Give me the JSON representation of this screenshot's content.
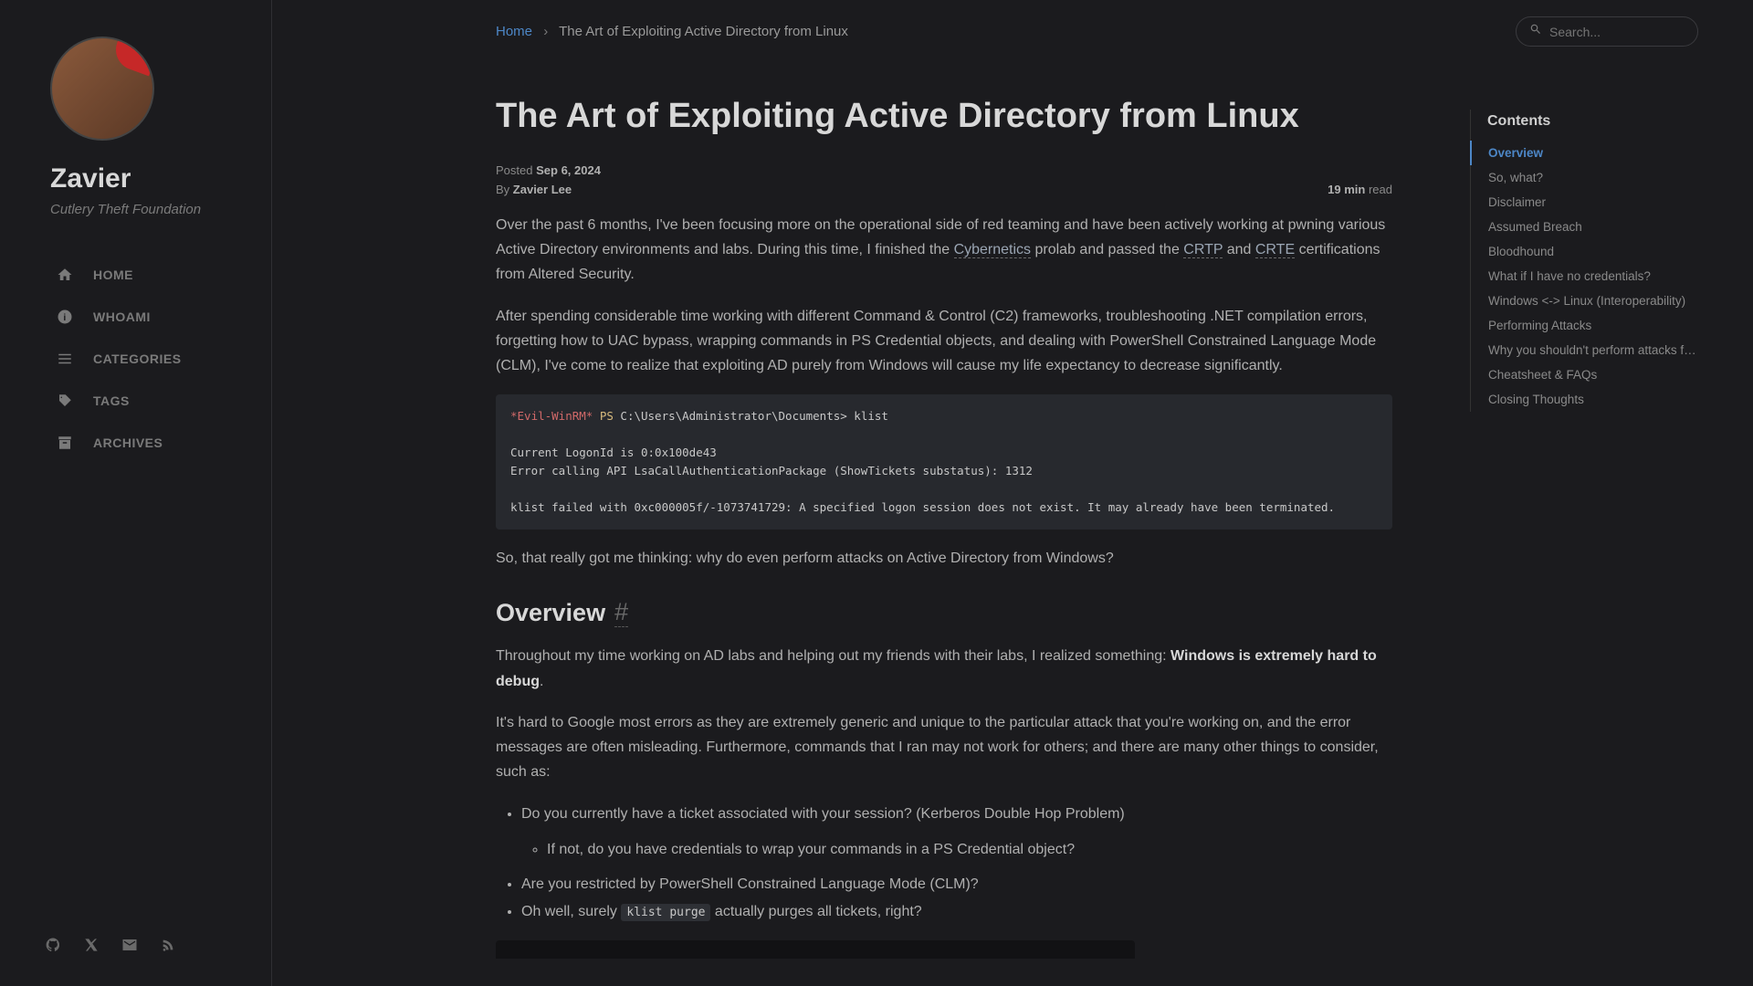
{
  "site": {
    "title": "Zavier",
    "subtitle": "Cutlery Theft Foundation"
  },
  "nav": [
    {
      "label": "HOME",
      "icon": "home"
    },
    {
      "label": "WHOAMI",
      "icon": "info"
    },
    {
      "label": "CATEGORIES",
      "icon": "list"
    },
    {
      "label": "TAGS",
      "icon": "tag"
    },
    {
      "label": "ARCHIVES",
      "icon": "archive"
    }
  ],
  "breadcrumb": {
    "home": "Home",
    "current": "The Art of Exploiting Active Directory from Linux"
  },
  "search": {
    "placeholder": "Search..."
  },
  "post": {
    "title": "The Art of Exploiting Active Directory from Linux",
    "posted_label": "Posted",
    "date": "Sep 6, 2024",
    "by_label": "By",
    "author": "Zavier Lee",
    "read_time_num": "19 min",
    "read_time_label": " read",
    "p1a": "Over the past 6 months, I've been focusing more on the operational side of red teaming and have been actively working at pwning various Active Directory environments and labs. During this time, I finished the ",
    "link_cyb": "Cybernetics",
    "p1b": " prolab and passed the ",
    "link_crtp": "CRTP",
    "p1c": " and ",
    "link_crte": "CRTE",
    "p1d": " certifications from Altered Security.",
    "p2": "After spending considerable time working with different Command & Control (C2) frameworks, troubleshooting .NET compilation errors, forgetting how to UAC bypass, wrapping commands in PS Credential objects, and dealing with PowerShell Constrained Language Mode (CLM), I've come to realize that exploiting AD purely from Windows will cause my life expectancy to decrease significantly.",
    "code_evil": "*Evil-WinRM*",
    "code_ps": " PS ",
    "code_path": "C:\\Users\\Administrator\\Documents> klist",
    "code_body": "Current LogonId is 0:0x100de43\nError calling API LsaCallAuthenticationPackage (ShowTickets substatus): 1312\n\nklist failed with 0xc000005f/-1073741729: A specified logon session does not exist. It may already have been terminated.",
    "p3": "So, that really got me thinking: why do even perform attacks on Active Directory from Windows?",
    "h_overview": "Overview",
    "p4a": "Throughout my time working on AD labs and helping out my friends with their labs, I realized something: ",
    "p4_strong": "Windows is extremely hard to debug",
    "p4b": ".",
    "p5": "It's hard to Google most errors as they are extremely generic and unique to the particular attack that you're working on, and the error messages are often misleading. Furthermore, commands that I ran may not work for others; and there are many other things to consider, such as:",
    "li1": "Do you currently have a ticket associated with your session? (Kerberos Double Hop Problem)",
    "li1a": "If not, do you have credentials to wrap your commands in a PS Credential object?",
    "li2": "Are you restricted by PowerShell Constrained Language Mode (CLM)?",
    "li3a": "Oh well, surely ",
    "li3_code": "klist purge",
    "li3b": " actually purges all tickets, right?"
  },
  "toc": {
    "title": "Contents",
    "items": [
      "Overview",
      "So, what?",
      "Disclaimer",
      "Assumed Breach",
      "Bloodhound",
      "What if I have no credentials?",
      "Windows <-> Linux (Interoperability)",
      "Performing Attacks",
      "Why you shouldn't perform attacks fro…",
      "Cheatsheet & FAQs",
      "Closing Thoughts"
    ],
    "active_index": 0
  }
}
